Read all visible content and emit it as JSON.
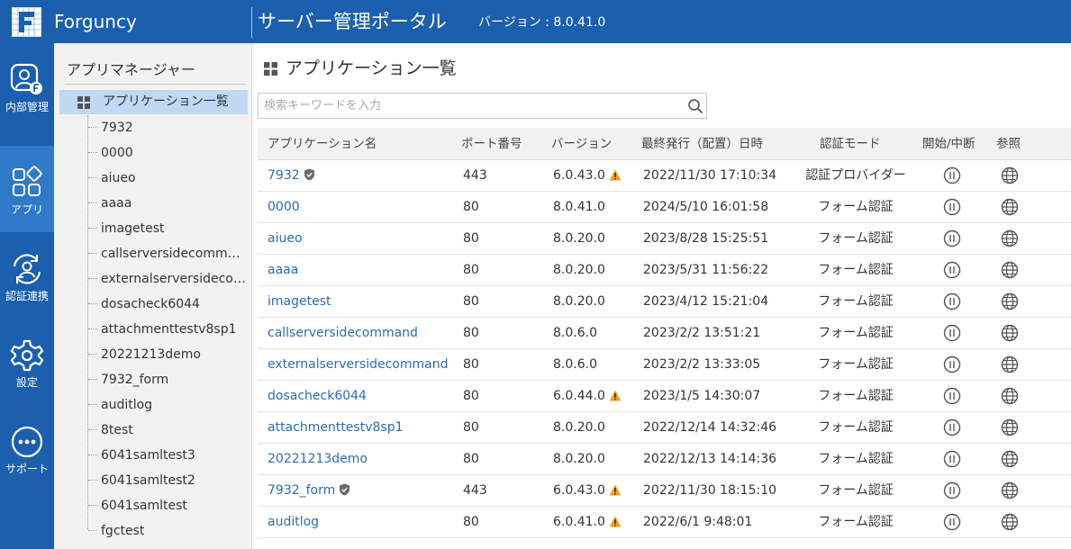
{
  "header": {
    "app_name": "Forguncy",
    "portal_title": "サーバー管理ポータル",
    "version_text": "バージョン : 8.0.41.0",
    "bar_color": "#1b5fae"
  },
  "nav": [
    {
      "label": "内部管理",
      "icon": "user-management-icon"
    },
    {
      "label": "アプリ",
      "icon": "apps-icon",
      "active": true
    },
    {
      "label": "認証連携",
      "icon": "auth-sync-icon"
    },
    {
      "label": "設定",
      "icon": "gear-icon"
    },
    {
      "label": "サポート",
      "icon": "support-icon"
    }
  ],
  "tree": {
    "title": "アプリマネージャー",
    "root_label": "アプリケーション一覧",
    "items": [
      "7932",
      "0000",
      "aiueo",
      "aaaa",
      "imagetest",
      "callserversidecommand",
      "externalserversideco…",
      "dosacheck6044",
      "attachmenttestv8sp1",
      "20221213demo",
      "7932_form",
      "auditlog",
      "8test",
      "6041samltest3",
      "6041samltest2",
      "6041samltest",
      "fgctest"
    ]
  },
  "main": {
    "title": "アプリケーション一覧",
    "search_placeholder": "検索キーワードを入力",
    "columns": {
      "name": "アプリケーション名",
      "port": "ポート番号",
      "version": "バージョン",
      "date": "最終発行（配置）日時",
      "auth": "認証モード",
      "toggle": "開始/中断",
      "browse": "参照"
    },
    "rows": [
      {
        "name": "7932",
        "port": "443",
        "version": "6.0.43.0",
        "date": "2022/11/30 17:10:34",
        "auth": "認証プロバイダー",
        "shield": true,
        "warn": true
      },
      {
        "name": "0000",
        "port": "80",
        "version": "8.0.41.0",
        "date": "2024/5/10 16:01:58",
        "auth": "フォーム認証",
        "shield": false,
        "warn": false
      },
      {
        "name": "aiueo",
        "port": "80",
        "version": "8.0.20.0",
        "date": "2023/8/28 15:25:51",
        "auth": "フォーム認証",
        "shield": false,
        "warn": false
      },
      {
        "name": "aaaa",
        "port": "80",
        "version": "8.0.20.0",
        "date": "2023/5/31 11:56:22",
        "auth": "フォーム認証",
        "shield": false,
        "warn": false
      },
      {
        "name": "imagetest",
        "port": "80",
        "version": "8.0.20.0",
        "date": "2023/4/12 15:21:04",
        "auth": "フォーム認証",
        "shield": false,
        "warn": false
      },
      {
        "name": "callserversidecommand",
        "port": "80",
        "version": "8.0.6.0",
        "date": "2023/2/2 13:51:21",
        "auth": "フォーム認証",
        "shield": false,
        "warn": false
      },
      {
        "name": "externalserversidecommand",
        "port": "80",
        "version": "8.0.6.0",
        "date": "2023/2/2 13:33:05",
        "auth": "フォーム認証",
        "shield": false,
        "warn": false
      },
      {
        "name": "dosacheck6044",
        "port": "80",
        "version": "6.0.44.0",
        "date": "2023/1/5 14:30:07",
        "auth": "フォーム認証",
        "shield": false,
        "warn": true
      },
      {
        "name": "attachmenttestv8sp1",
        "port": "80",
        "version": "8.0.20.0",
        "date": "2022/12/14 14:32:46",
        "auth": "フォーム認証",
        "shield": false,
        "warn": false
      },
      {
        "name": "20221213demo",
        "port": "80",
        "version": "8.0.20.0",
        "date": "2022/12/13 14:14:36",
        "auth": "フォーム認証",
        "shield": false,
        "warn": false
      },
      {
        "name": "7932_form",
        "port": "443",
        "version": "6.0.43.0",
        "date": "2022/11/30 18:15:10",
        "auth": "フォーム認証",
        "shield": true,
        "warn": true
      },
      {
        "name": "auditlog",
        "port": "80",
        "version": "6.0.41.0",
        "date": "2022/6/1 9:48:01",
        "auth": "フォーム認証",
        "shield": false,
        "warn": true
      }
    ]
  }
}
